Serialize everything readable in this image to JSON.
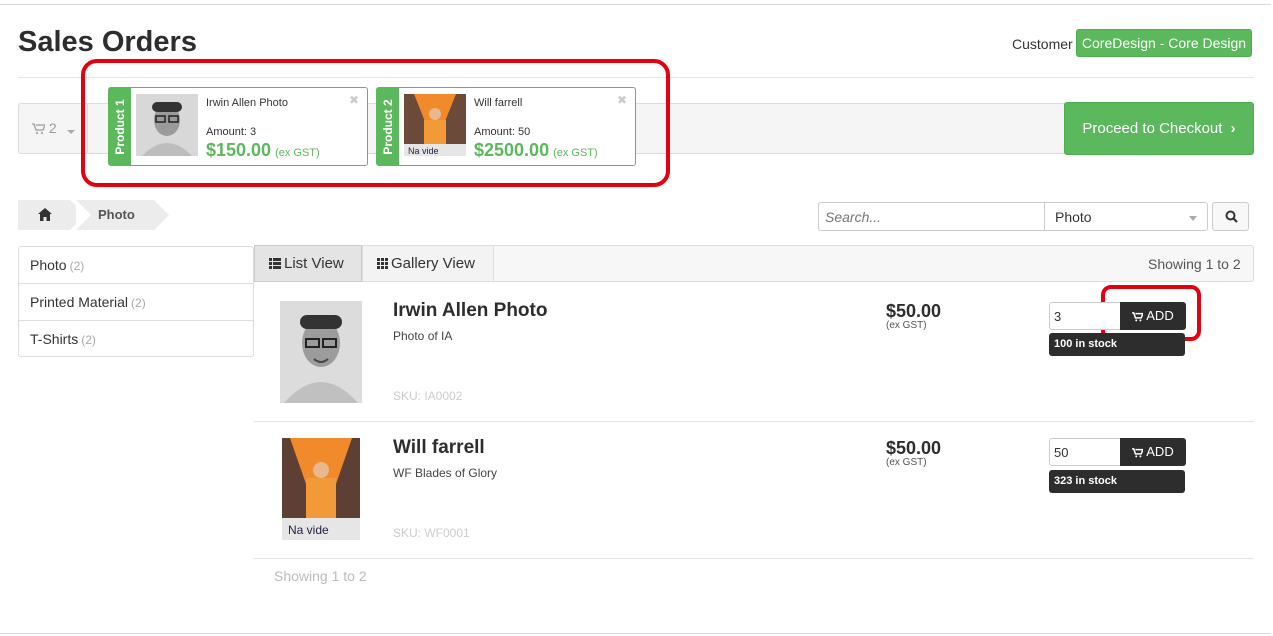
{
  "page": {
    "title": "Sales Orders"
  },
  "customer": {
    "label": "Customer",
    "value": "CoreDesign - Core Design"
  },
  "cart": {
    "count": "2",
    "checkout_label": "Proceed to Checkout",
    "items": [
      {
        "tab": "Product 1",
        "name": "Irwin Allen Photo",
        "amount": "Amount: 3",
        "price": "$150.00",
        "tax": "(ex GST)"
      },
      {
        "tab": "Product 2",
        "name": "Will farrell",
        "amount": "Amount: 50",
        "price": "$2500.00",
        "tax": "(ex GST)"
      }
    ]
  },
  "breadcrumb": {
    "current": "Photo"
  },
  "search": {
    "placeholder": "Search...",
    "category": "Photo"
  },
  "sidebar": {
    "items": [
      {
        "label": "Photo",
        "count": "(2)"
      },
      {
        "label": "Printed Material",
        "count": "(2)"
      },
      {
        "label": "T-Shirts",
        "count": "(2)"
      }
    ]
  },
  "views": {
    "list": "List View",
    "gallery": "Gallery View"
  },
  "showing": "Showing 1 to 2",
  "products": [
    {
      "name": "Irwin Allen Photo",
      "desc": "Photo of IA",
      "sku": "SKU: IA0002",
      "price": "$50.00",
      "tax": "(ex GST)",
      "qty": "3",
      "add": "ADD",
      "stock": "100 in stock"
    },
    {
      "name": "Will farrell",
      "desc": "WF Blades of Glory",
      "sku": "SKU: WF0001",
      "price": "$50.00",
      "tax": "(ex GST)",
      "qty": "50",
      "add": "ADD",
      "stock": "323 in stock"
    }
  ],
  "colors": {
    "accent_green": "#5cb85c",
    "dark": "#2d2d2d",
    "highlight_red": "#e3000f"
  },
  "icons": [
    "cart-icon",
    "caret-down-icon",
    "close-icon",
    "chevron-right-icon",
    "home-icon",
    "search-icon",
    "list-icon",
    "grid-icon"
  ]
}
